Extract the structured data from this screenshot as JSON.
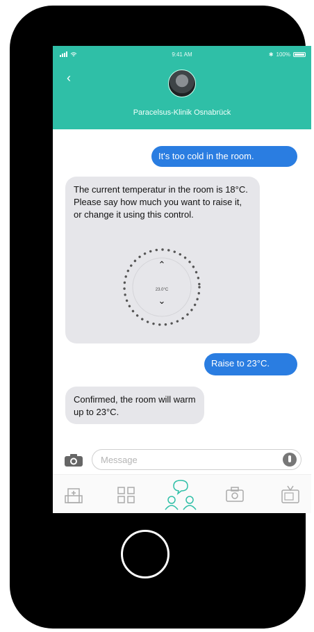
{
  "status_bar": {
    "time": "9:41 AM",
    "battery": "100%"
  },
  "header": {
    "back_glyph": "‹",
    "contact_name": "Paracelsus-Klinik Osnabrück"
  },
  "messages": [
    {
      "sender": "user",
      "text": "It's too cold in the room."
    },
    {
      "sender": "clinic",
      "text": "The current temperatur in the room is 18°C. Please say how much you want to raise it, or change it using this control."
    },
    {
      "sender": "user",
      "text": "Raise to 23°C."
    },
    {
      "sender": "clinic",
      "text": "Confirmed, the room will warm up to 23°C."
    }
  ],
  "thermostat": {
    "value": "23.0°C",
    "up_glyph": "⌃",
    "down_glyph": "⌄"
  },
  "composer": {
    "placeholder": "Message"
  },
  "tabs": [
    {
      "icon": "hospital-icon"
    },
    {
      "icon": "grid-icon"
    },
    {
      "icon": "chat-people-icon",
      "active": true
    },
    {
      "icon": "camera-icon"
    },
    {
      "icon": "tv-icon"
    }
  ],
  "colors": {
    "brand": "#2fbfa7",
    "outgoing": "#2a7de1",
    "incoming": "#e6e6ea"
  }
}
